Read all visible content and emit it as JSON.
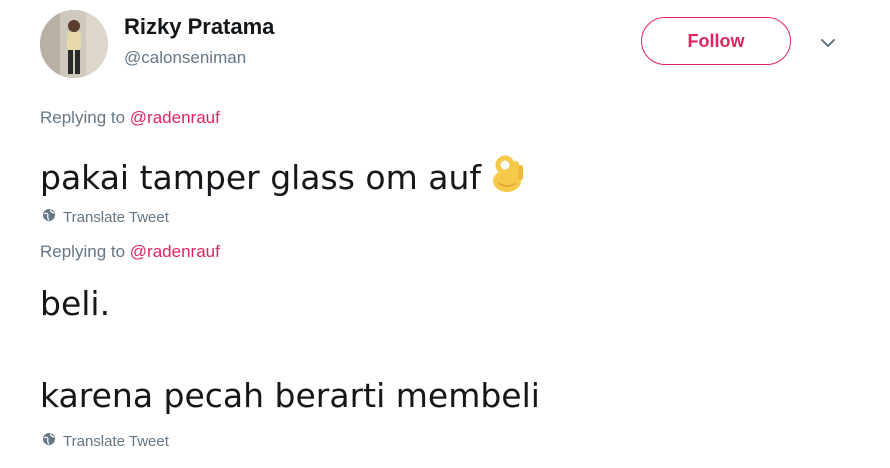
{
  "profile": {
    "display_name": "Rizky Pratama",
    "handle": "@calonseniman",
    "follow_label": "Follow",
    "caret_icon": "chevron-down-icon"
  },
  "tweets": [
    {
      "reply_prefix": "Replying to",
      "reply_to": "@radenrauf",
      "lines": [
        "pakai tamper glass om auf"
      ],
      "emoji": "ok-hand-icon",
      "translate_label": "Translate Tweet"
    },
    {
      "reply_prefix": "Replying to",
      "reply_to": "@radenrauf",
      "lines": [
        "beli.",
        "karena pecah berarti membeli"
      ],
      "translate_label": "Translate Tweet"
    }
  ],
  "colors": {
    "accent": "#e0245e",
    "secondary_text": "#657786",
    "primary_text": "#14171a"
  }
}
